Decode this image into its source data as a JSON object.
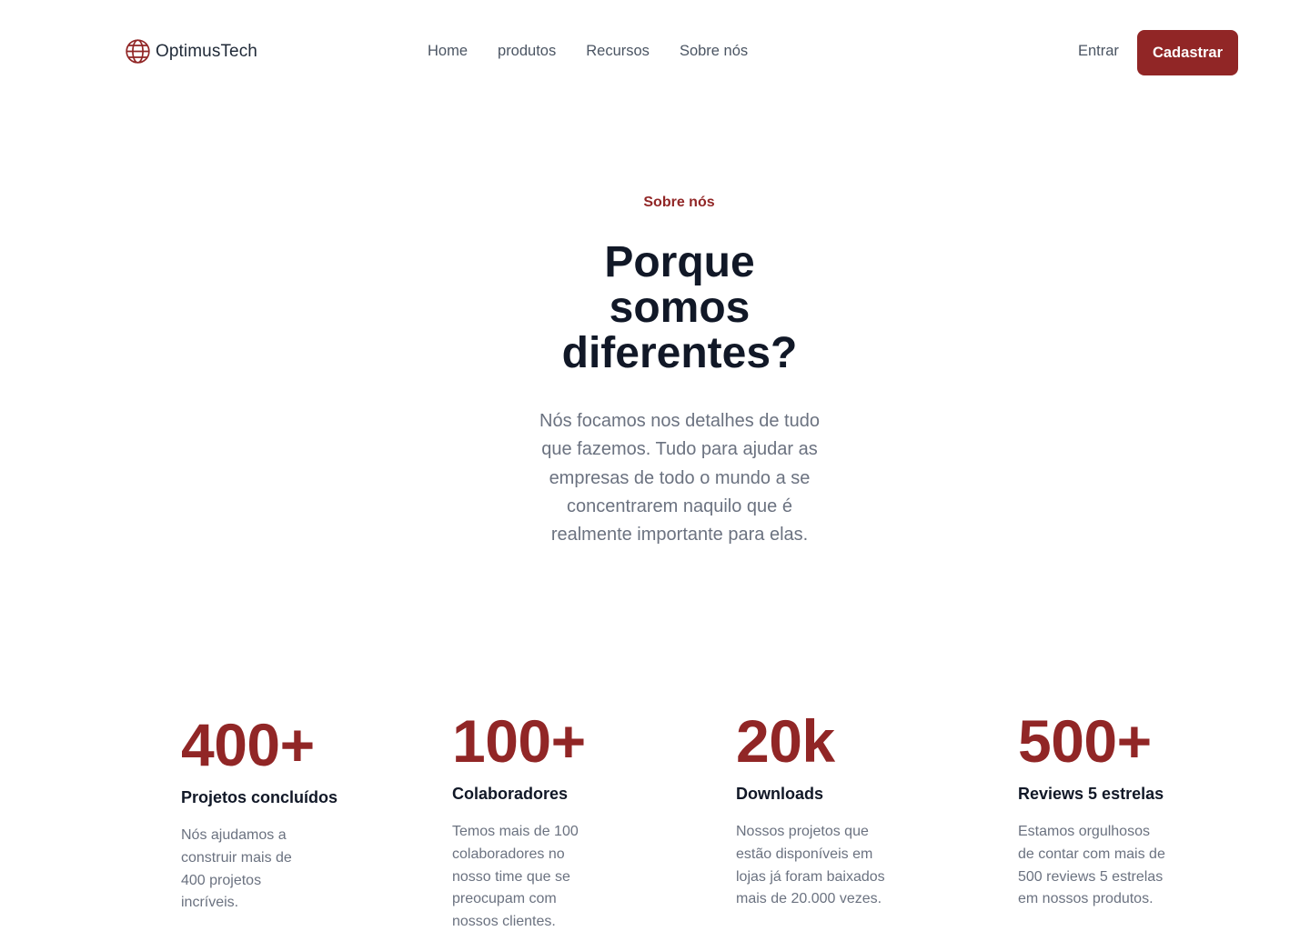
{
  "brand": {
    "name": "OptimusTech",
    "icon": "globe-icon",
    "accent_color": "#912626"
  },
  "nav": {
    "links": [
      "Home",
      "produtos",
      "Recursos",
      "Sobre nós"
    ],
    "signin_label": "Entrar",
    "signup_label": "Cadastrar"
  },
  "hero": {
    "eyebrow": "Sobre nós",
    "headline": "Porque somos diferentes?",
    "lead": "Nós focamos nos detalhes de tudo que fazemos. Tudo para ajudar as empresas de todo o mundo a se concentrarem naquilo que é realmente importante para elas."
  },
  "stats": [
    {
      "value": "400+",
      "label": "Projetos concluídos",
      "description": "Nós ajudamos a construir mais de 400 projetos incríveis."
    },
    {
      "value": "100+",
      "label": "Colaboradores",
      "description": "Temos mais de 100 colaboradores no nosso time que se preocupam com nossos clientes."
    },
    {
      "value": "20k",
      "label": "Downloads",
      "description": "Nossos projetos que estão disponíveis em lojas já foram baixados mais de 20.000 vezes."
    },
    {
      "value": "500+",
      "label": "Reviews 5 estrelas",
      "description": "Estamos orgulhosos de contar com mais de 500 reviews 5 estrelas em nossos produtos."
    }
  ]
}
